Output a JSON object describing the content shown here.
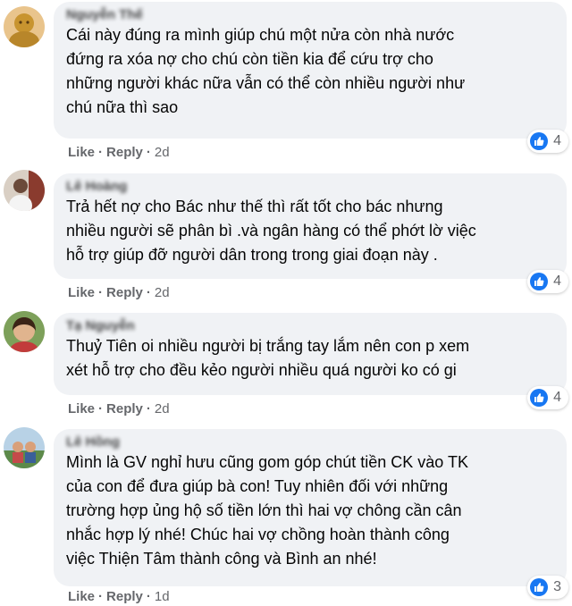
{
  "comments": [
    {
      "name": "Nguyễn Thế",
      "text": "Cái này đúng ra mình giúp chú một nửa còn nhà nước\nđứng ra xóa nợ cho chú còn tiền kia để cứu trợ cho\nnhững người khác nữa vẫn có thể còn nhiều người như\nchú nữa thì sao",
      "like_label": "Like",
      "reply_label": "Reply",
      "time": "2d",
      "reaction_count": "4",
      "reaction_icon": "like-icon"
    },
    {
      "name": "Lê Hoàng",
      "text": "Trả hết nợ cho Bác như thế thì rất tốt cho bác nhưng\nnhiều người sẽ phân bì .và ngân hàng có thể phớt lờ việc\nhỗ trợ giúp đỡ người dân trong trong giai đoạn này .",
      "like_label": "Like",
      "reply_label": "Reply",
      "time": "2d",
      "reaction_count": "4",
      "reaction_icon": "like-icon"
    },
    {
      "name": "Tạ Nguyễn",
      "text": "Thuỷ Tiên oi nhiều người bị trắng tay lắm nên con p xem\nxét hỗ trợ cho đều kẻo người nhiều quá người ko có gi",
      "like_label": "Like",
      "reply_label": "Reply",
      "time": "2d",
      "reaction_count": "4",
      "reaction_icon": "like-icon"
    },
    {
      "name": "Lê Hồng",
      "text": "Mình là GV nghỉ hưu cũng gom góp chút tiền CK vào TK\ncủa con để đưa giúp bà con! Tuy nhiên đối với những\ntrường hợp ủng hộ số tiền lớn thì hai vợ chông cần cân\nnhắc hợp lý nhé! Chúc hai vợ chồng hoàn thành công\nviệc Thiện Tâm thành công và Bình an nhé!",
      "like_label": "Like",
      "reply_label": "Reply",
      "time": "1d",
      "reaction_count": "3",
      "reaction_icon": "like-icon"
    }
  ],
  "colors": {
    "bubble_bg": "#f0f2f5",
    "meta_text": "#65676b",
    "like_blue": "#1877f2"
  }
}
